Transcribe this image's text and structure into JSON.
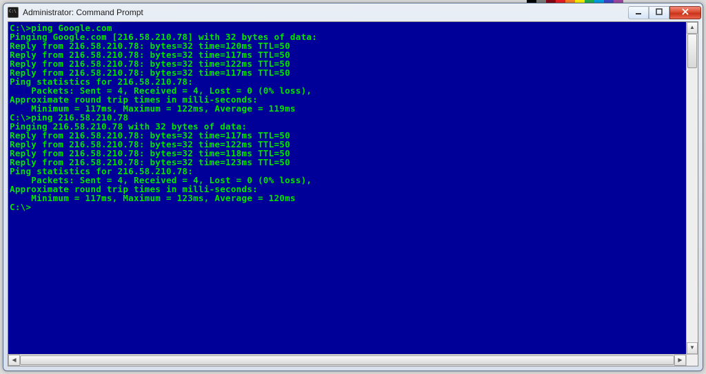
{
  "window": {
    "title": "Administrator: Command Prompt"
  },
  "terminal": {
    "prompt1": "C:\\>ping Google.com",
    "blank1": "",
    "l1": "Pinging Google.com [216.58.210.78] with 32 bytes of data:",
    "l2": "Reply from 216.58.210.78: bytes=32 time=120ms TTL=50",
    "l3": "Reply from 216.58.210.78: bytes=32 time=117ms TTL=50",
    "l4": "Reply from 216.58.210.78: bytes=32 time=122ms TTL=50",
    "l5": "Reply from 216.58.210.78: bytes=32 time=117ms TTL=50",
    "blank2": "",
    "l6": "Ping statistics for 216.58.210.78:",
    "l7": "    Packets: Sent = 4, Received = 4, Lost = 0 (0% loss),",
    "l8": "Approximate round trip times in milli-seconds:",
    "l9": "    Minimum = 117ms, Maximum = 122ms, Average = 119ms",
    "blank3": "",
    "prompt2": "C:\\>ping 216.58.210.78",
    "blank4": "",
    "m1": "Pinging 216.58.210.78 with 32 bytes of data:",
    "m2": "Reply from 216.58.210.78: bytes=32 time=117ms TTL=50",
    "m3": "Reply from 216.58.210.78: bytes=32 time=122ms TTL=50",
    "m4": "Reply from 216.58.210.78: bytes=32 time=118ms TTL=50",
    "m5": "Reply from 216.58.210.78: bytes=32 time=123ms TTL=50",
    "blank5": "",
    "m6": "Ping statistics for 216.58.210.78:",
    "m7": "    Packets: Sent = 4, Received = 4, Lost = 0 (0% loss),",
    "m8": "Approximate round trip times in milli-seconds:",
    "m9": "    Minimum = 117ms, Maximum = 123ms, Average = 120ms",
    "blank6": "",
    "prompt3": "C:\\>"
  }
}
